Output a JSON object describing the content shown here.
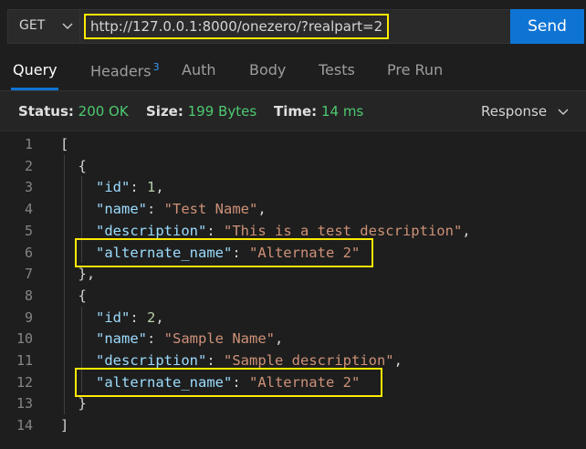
{
  "request": {
    "method": "GET",
    "url": "http://127.0.0.1:8000/onezero/?realpart=2",
    "send_label": "Send"
  },
  "tabs": [
    {
      "label": "Query",
      "active": true
    },
    {
      "label": "Headers",
      "badge": "3"
    },
    {
      "label": "Auth"
    },
    {
      "label": "Body"
    },
    {
      "label": "Tests"
    },
    {
      "label": "Pre Run"
    }
  ],
  "status": {
    "status_label": "Status:",
    "status_value": "200 OK",
    "size_label": "Size:",
    "size_value": "199 Bytes",
    "time_label": "Time:",
    "time_value": "14 ms",
    "view_select": "Response"
  },
  "code": {
    "line_numbers": [
      "1",
      "2",
      "3",
      "4",
      "5",
      "6",
      "7",
      "8",
      "9",
      "10",
      "11",
      "12",
      "13",
      "14"
    ],
    "lines": [
      {
        "indent": 0,
        "punc": "["
      },
      {
        "indent": 1,
        "punc": "{"
      },
      {
        "indent": 2,
        "key": "\"id\"",
        "sep": ": ",
        "num": "1",
        "end": ","
      },
      {
        "indent": 2,
        "key": "\"name\"",
        "sep": ": ",
        "str": "\"Test Name\"",
        "end": ","
      },
      {
        "indent": 2,
        "key": "\"description\"",
        "sep": ": ",
        "str": "\"This is a test description\"",
        "end": ","
      },
      {
        "indent": 2,
        "key": "\"alternate_name\"",
        "sep": ": ",
        "str": "\"Alternate 2\"",
        "end": ""
      },
      {
        "indent": 1,
        "punc": "},"
      },
      {
        "indent": 1,
        "punc": "{"
      },
      {
        "indent": 2,
        "key": "\"id\"",
        "sep": ": ",
        "num": "2",
        "end": ","
      },
      {
        "indent": 2,
        "key": "\"name\"",
        "sep": ": ",
        "str": "\"Sample Name\"",
        "end": ","
      },
      {
        "indent": 2,
        "key": "\"description\"",
        "sep": ": ",
        "str": "\"Sample description\"",
        "end": ","
      },
      {
        "indent": 2,
        "key": "\"alternate_name\"",
        "sep": ": ",
        "str": "\"Alternate 2\"",
        "end": ""
      },
      {
        "indent": 1,
        "punc": "}"
      },
      {
        "indent": 0,
        "punc": "]"
      }
    ]
  },
  "colors": {
    "accent": "#0e74d4",
    "highlight": "#ffea00",
    "status_ok": "#4ec96f"
  },
  "icons": [
    "chevron-down-icon"
  ]
}
